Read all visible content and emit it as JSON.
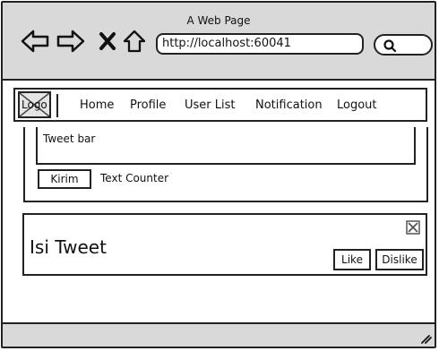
{
  "window": {
    "title": "A Web Page"
  },
  "browser": {
    "url": "http://localhost:60041",
    "icons": [
      "back-arrow-icon",
      "forward-arrow-icon",
      "stop-icon",
      "home-icon",
      "search-icon"
    ]
  },
  "navbar": {
    "logo": "Logo",
    "links": [
      "Home",
      "Profile",
      "User List",
      "Notification",
      "Logout"
    ]
  },
  "compose": {
    "tweet_bar": "Tweet bar",
    "submit_label": "Kirim",
    "counter_label": "Text Counter"
  },
  "tweet": {
    "content": "Isi Tweet",
    "like_label": "Like",
    "dislike_label": "Dislike"
  }
}
